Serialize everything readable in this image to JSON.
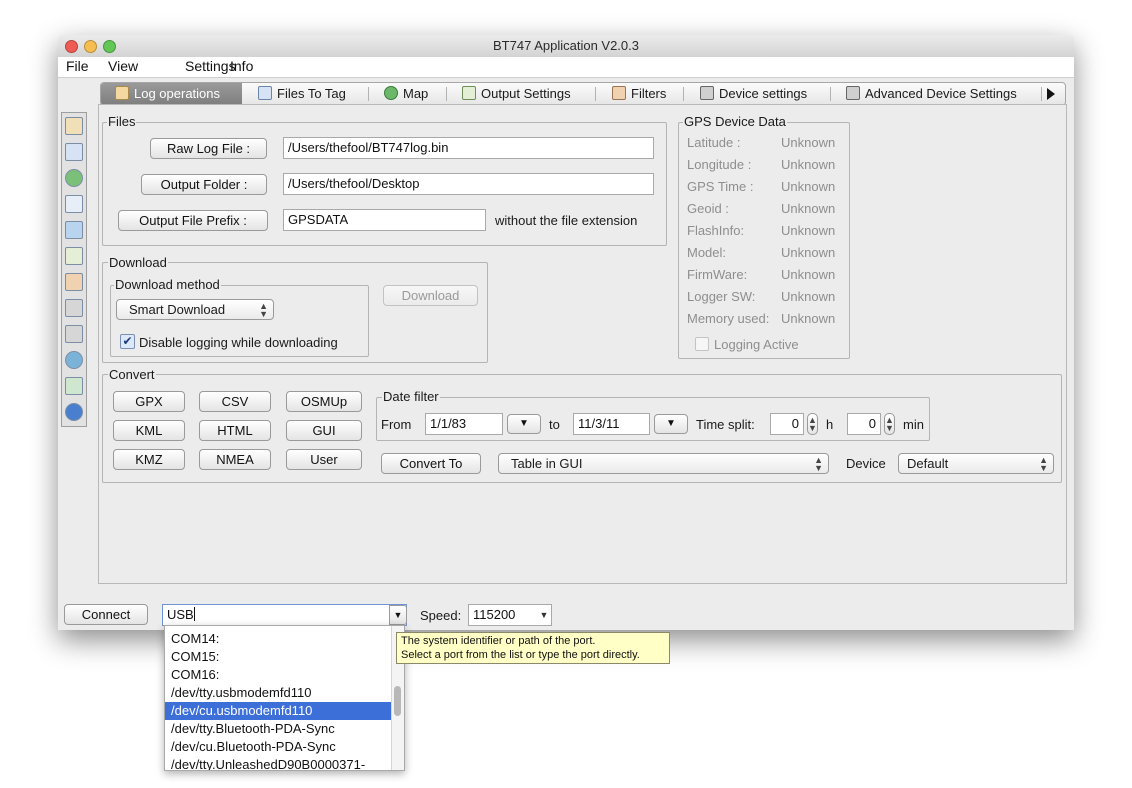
{
  "window": {
    "title": "BT747 Application V2.0.3"
  },
  "menubar": [
    "File",
    "View",
    "Settings",
    "Info"
  ],
  "tabs": [
    {
      "label": "Log operations",
      "icon": "house-icon",
      "active": true
    },
    {
      "label": "Files To Tag",
      "icon": "files-icon"
    },
    {
      "label": "Map",
      "icon": "globe-icon"
    },
    {
      "label": "Output Settings",
      "icon": "output-icon"
    },
    {
      "label": "Filters",
      "icon": "hourglass-icon"
    },
    {
      "label": "Device settings",
      "icon": "wrench-icon"
    },
    {
      "label": "Advanced Device Settings",
      "icon": "wrench-gear-icon"
    }
  ],
  "files": {
    "legend": "Files",
    "raw_log_button": "Raw Log File :",
    "raw_log_value": "/Users/thefool/BT747log.bin",
    "output_folder_button": "Output Folder :",
    "output_folder_value": "/Users/thefool/Desktop",
    "prefix_button": "Output File Prefix :",
    "prefix_value": "GPSDATA",
    "prefix_note": "without the file extension"
  },
  "gps": {
    "legend": "GPS Device Data",
    "rows": [
      {
        "label": "Latitude :",
        "value": "Unknown"
      },
      {
        "label": "Longitude :",
        "value": "Unknown"
      },
      {
        "label": "GPS Time :",
        "value": "Unknown"
      },
      {
        "label": "Geoid :",
        "value": "Unknown"
      },
      {
        "label": "FlashInfo:",
        "value": "Unknown"
      },
      {
        "label": "Model:",
        "value": "Unknown"
      },
      {
        "label": "FirmWare:",
        "value": "Unknown"
      },
      {
        "label": "Logger SW:",
        "value": "Unknown"
      },
      {
        "label": "Memory used:",
        "value": "Unknown"
      }
    ],
    "logging_active": "Logging Active"
  },
  "download": {
    "legend": "Download",
    "method_legend": "Download method",
    "method_value": "Smart Download",
    "disable_logging": "Disable logging while downloading",
    "download_button": "Download"
  },
  "convert": {
    "legend": "Convert",
    "formats": [
      "GPX",
      "CSV",
      "OSMUp",
      "KML",
      "HTML",
      "GUI",
      "KMZ",
      "NMEA",
      "User"
    ],
    "date_filter_legend": "Date filter",
    "from_label": "From",
    "from_value": "1/1/83",
    "to_label": "to",
    "to_value": "11/3/11",
    "time_split_label": "Time split:",
    "hours_value": "0",
    "h_label": "h",
    "minutes_value": "0",
    "min_label": "min",
    "convert_to_button": "Convert To",
    "convert_target": "Table in GUI",
    "device_label": "Device",
    "device_value": "Default"
  },
  "bottom": {
    "connect_button": "Connect",
    "port_value": "USB",
    "speed_label": "Speed:",
    "speed_value": "115200"
  },
  "port_dropdown": {
    "items": [
      "COM14:",
      "COM15:",
      "COM16:",
      "/dev/tty.usbmodemfd110",
      "/dev/cu.usbmodemfd110",
      "/dev/tty.Bluetooth-PDA-Sync",
      "/dev/cu.Bluetooth-PDA-Sync",
      "/dev/tty.UnleashedD90B0000371-"
    ],
    "selected": "/dev/cu.usbmodemfd110"
  },
  "tooltip": {
    "line1": "The system identifier or path of the port.",
    "line2": "Select a port from the list or type the port directly."
  },
  "colors": {
    "selection": "#3d6fd9",
    "tooltip_bg": "#ffffc6",
    "active_tab": "#8a8a8a"
  }
}
